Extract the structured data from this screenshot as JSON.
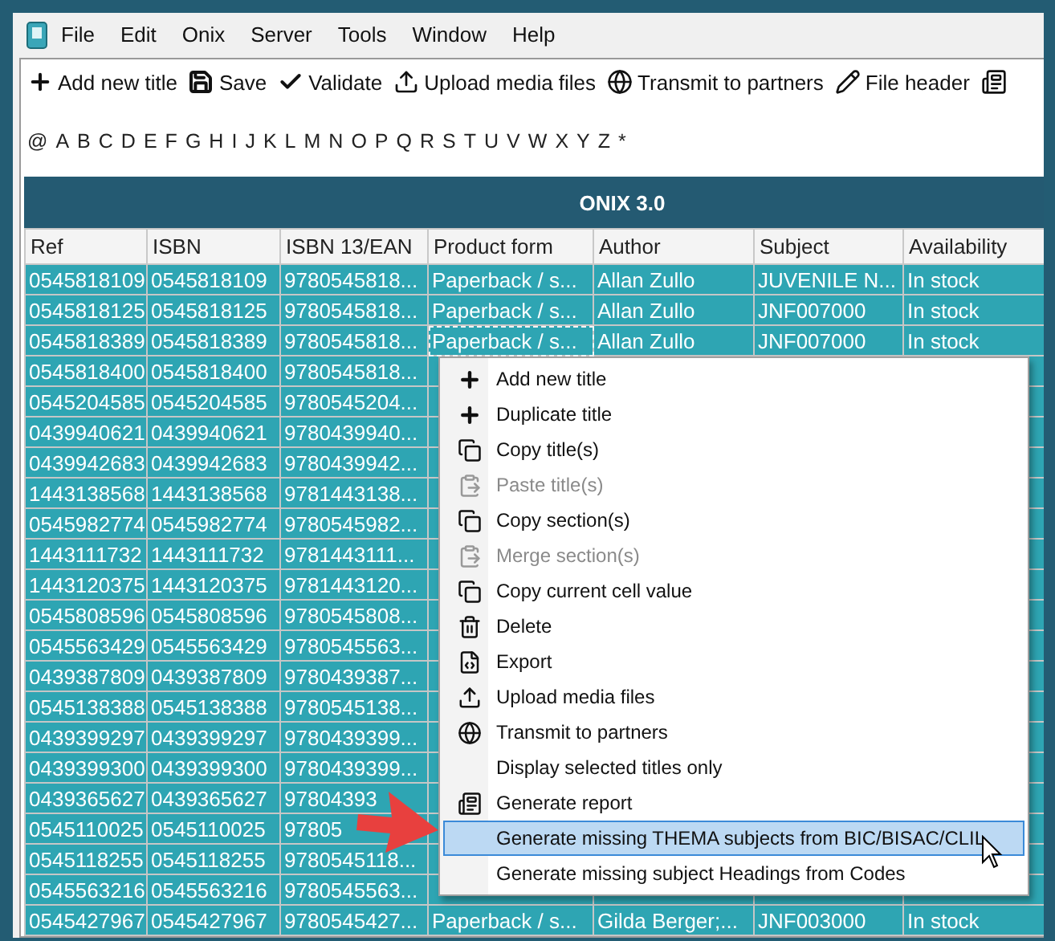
{
  "menu_bar": {
    "items": [
      "File",
      "Edit",
      "Onix",
      "Server",
      "Tools",
      "Window",
      "Help"
    ]
  },
  "toolbar": {
    "items": [
      "Add new title",
      "Save",
      "Validate",
      "Upload media files",
      "Transmit to partners",
      "File header"
    ]
  },
  "alphabet": [
    "@",
    "A",
    "B",
    "C",
    "D",
    "E",
    "F",
    "G",
    "H",
    "I",
    "J",
    "K",
    "L",
    "M",
    "N",
    "O",
    "P",
    "Q",
    "R",
    "S",
    "T",
    "U",
    "V",
    "W",
    "X",
    "Y",
    "Z",
    "*"
  ],
  "band_title": "ONIX 3.0",
  "table": {
    "columns": [
      "Ref",
      "ISBN",
      "ISBN 13/EAN",
      "Product form",
      "Author",
      "Subject",
      "Availability"
    ],
    "rows": [
      {
        "selected": true,
        "focused": false,
        "cells": [
          "0545818109",
          "0545818109",
          "9780545818...",
          "Paperback / s...",
          "Allan Zullo",
          "JUVENILE N...",
          "In stock"
        ]
      },
      {
        "selected": true,
        "focused": false,
        "cells": [
          "0545818125",
          "0545818125",
          "9780545818...",
          "Paperback / s...",
          "Allan Zullo",
          "JNF007000",
          "In stock"
        ]
      },
      {
        "selected": true,
        "focused": true,
        "cells": [
          "0545818389",
          "0545818389",
          "9780545818...",
          "Paperback / s...",
          "Allan Zullo",
          "JNF007000",
          "In stock"
        ]
      },
      {
        "selected": true,
        "focused": false,
        "cells": [
          "0545818400",
          "0545818400",
          "9780545818..."
        ]
      },
      {
        "selected": true,
        "focused": false,
        "cells": [
          "0545204585",
          "0545204585",
          "9780545204..."
        ]
      },
      {
        "selected": true,
        "focused": false,
        "cells": [
          "0439940621",
          "0439940621",
          "9780439940..."
        ]
      },
      {
        "selected": true,
        "focused": false,
        "cells": [
          "0439942683",
          "0439942683",
          "9780439942..."
        ]
      },
      {
        "selected": true,
        "focused": false,
        "cells": [
          "1443138568",
          "1443138568",
          "9781443138..."
        ]
      },
      {
        "selected": true,
        "focused": false,
        "cells": [
          "0545982774",
          "0545982774",
          "9780545982..."
        ]
      },
      {
        "selected": true,
        "focused": false,
        "cells": [
          "1443111732",
          "1443111732",
          "9781443111..."
        ]
      },
      {
        "selected": true,
        "focused": false,
        "cells": [
          "1443120375",
          "1443120375",
          "9781443120..."
        ]
      },
      {
        "selected": true,
        "focused": false,
        "cells": [
          "0545808596",
          "0545808596",
          "9780545808..."
        ]
      },
      {
        "selected": true,
        "focused": false,
        "cells": [
          "0545563429",
          "0545563429",
          "9780545563..."
        ]
      },
      {
        "selected": true,
        "focused": false,
        "cells": [
          "0439387809",
          "0439387809",
          "9780439387..."
        ]
      },
      {
        "selected": true,
        "focused": false,
        "cells": [
          "0545138388",
          "0545138388",
          "9780545138..."
        ]
      },
      {
        "selected": true,
        "focused": false,
        "cells": [
          "0439399297",
          "0439399297",
          "9780439399..."
        ]
      },
      {
        "selected": true,
        "focused": false,
        "cells": [
          "0439399300",
          "0439399300",
          "9780439399..."
        ]
      },
      {
        "selected": true,
        "focused": false,
        "cells": [
          "0439365627",
          "0439365627",
          "97804393"
        ]
      },
      {
        "selected": true,
        "focused": false,
        "cells": [
          "0545110025",
          "0545110025",
          "97805"
        ]
      },
      {
        "selected": true,
        "focused": false,
        "cells": [
          "0545118255",
          "0545118255",
          "9780545118..."
        ]
      },
      {
        "selected": true,
        "focused": false,
        "cells": [
          "0545563216",
          "0545563216",
          "9780545563..."
        ]
      },
      {
        "selected": true,
        "focused": false,
        "cells": [
          "0545427967",
          "0545427967",
          "9780545427...",
          "Paperback / s...",
          "Gilda Berger;...",
          "JNF003000",
          "In stock"
        ]
      }
    ]
  },
  "context_menu": {
    "items": [
      {
        "label": "Add new title",
        "disabled": false,
        "selected": false
      },
      {
        "label": "Duplicate title",
        "disabled": false,
        "selected": false
      },
      {
        "label": "Copy title(s)",
        "disabled": false,
        "selected": false
      },
      {
        "label": "Paste title(s)",
        "disabled": true,
        "selected": false
      },
      {
        "label": "Copy section(s)",
        "disabled": false,
        "selected": false
      },
      {
        "label": "Merge section(s)",
        "disabled": true,
        "selected": false
      },
      {
        "label": "Copy current cell value",
        "disabled": false,
        "selected": false
      },
      {
        "label": "Delete",
        "disabled": false,
        "selected": false
      },
      {
        "label": "Export",
        "disabled": false,
        "selected": false
      },
      {
        "label": "Upload media files",
        "disabled": false,
        "selected": false
      },
      {
        "label": "Transmit to partners",
        "disabled": false,
        "selected": false
      },
      {
        "label": "Display selected titles only",
        "disabled": false,
        "selected": false
      },
      {
        "label": "Generate report",
        "disabled": false,
        "selected": false
      },
      {
        "label": "Generate missing THEMA subjects from BIC/BISAC/CLIL",
        "disabled": false,
        "selected": true
      },
      {
        "label": "Generate missing subject Headings from Codes",
        "disabled": false,
        "selected": false
      }
    ]
  }
}
